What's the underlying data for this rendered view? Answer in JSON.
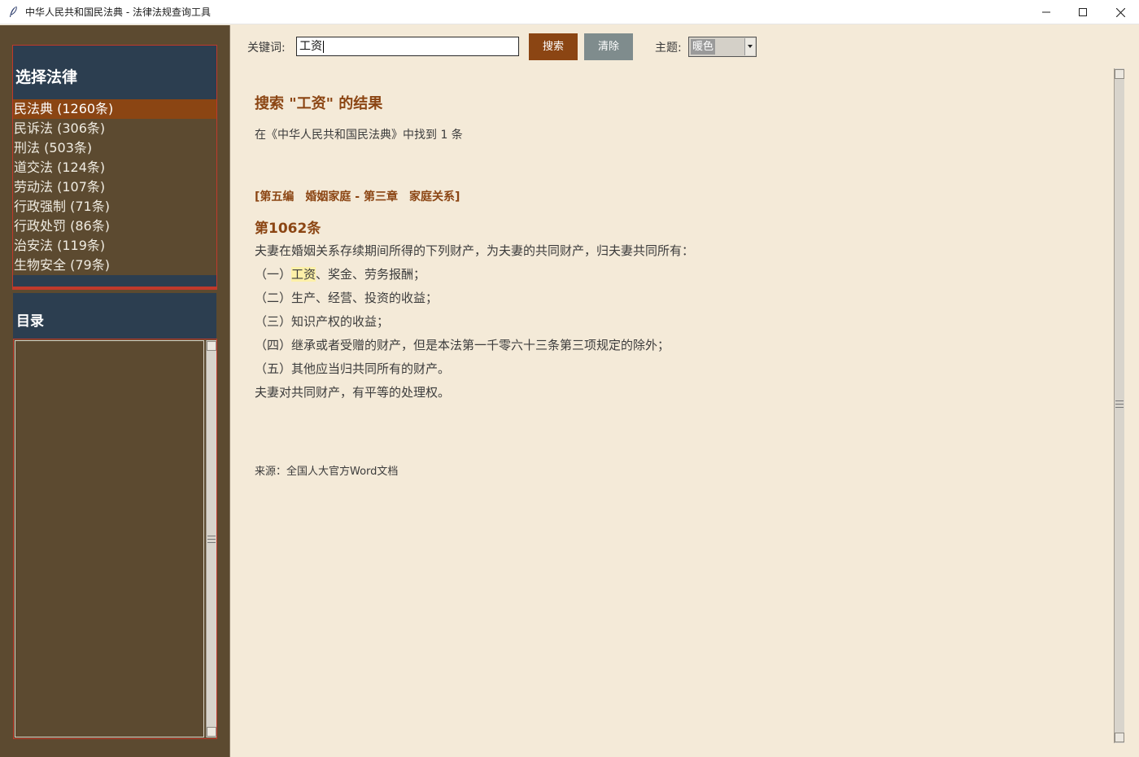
{
  "window": {
    "title": "中华人民共和国民法典 - 法律法规查询工具"
  },
  "sidebar": {
    "law_heading": "选择法律",
    "laws": [
      {
        "label": "民法典 (1260条)",
        "selected": true
      },
      {
        "label": "民诉法 (306条)"
      },
      {
        "label": "刑法 (503条)"
      },
      {
        "label": "道交法 (124条)"
      },
      {
        "label": "劳动法 (107条)"
      },
      {
        "label": "行政强制 (71条)"
      },
      {
        "label": "行政处罚 (86条)"
      },
      {
        "label": "治安法 (119条)"
      },
      {
        "label": "生物安全 (79条)"
      }
    ],
    "toc_heading": "目录"
  },
  "toolbar": {
    "keyword_label": "关键词:",
    "keyword_value": "工资",
    "search_label": "搜索",
    "clear_label": "清除",
    "theme_label": "主题:",
    "theme_value": "暖色"
  },
  "result": {
    "title": "搜索 \"工资\" 的结果",
    "summary": "在《中华人民共和国民法典》中找到 1 条",
    "chapter": "[第五编　婚姻家庭 - 第三章　家庭关系]",
    "article_no": "第1062条",
    "intro": "夫妻在婚姻关系存续期间所得的下列财产，为夫妻的共同财产，归夫妻共同所有：",
    "item1_prefix": "（一）",
    "item1_highlight": "工资",
    "item1_rest": "、奖金、劳务报酬；",
    "item2": "（二）生产、经营、投资的收益；",
    "item3": "（三）知识产权的收益；",
    "item4": "（四）继承或者受赠的财产，但是本法第一千零六十三条第三项规定的除外；",
    "item5": "（五）其他应当归共同所有的财产。",
    "closing": "夫妻对共同财产，有平等的处理权。",
    "source": "来源：全国人大官方Word文档"
  },
  "colors": {
    "accent": "#8b4513",
    "sidebar_bg": "#5c4a30",
    "panel_header": "#2c3e50",
    "border_red": "#c0392b",
    "content_bg": "#f4ead8",
    "highlight": "#fdf0a8",
    "clear_button": "#7f8c8d"
  },
  "icons": {
    "app": "feather-icon",
    "minimize": "minimize-icon",
    "maximize": "maximize-icon",
    "close": "close-icon"
  }
}
